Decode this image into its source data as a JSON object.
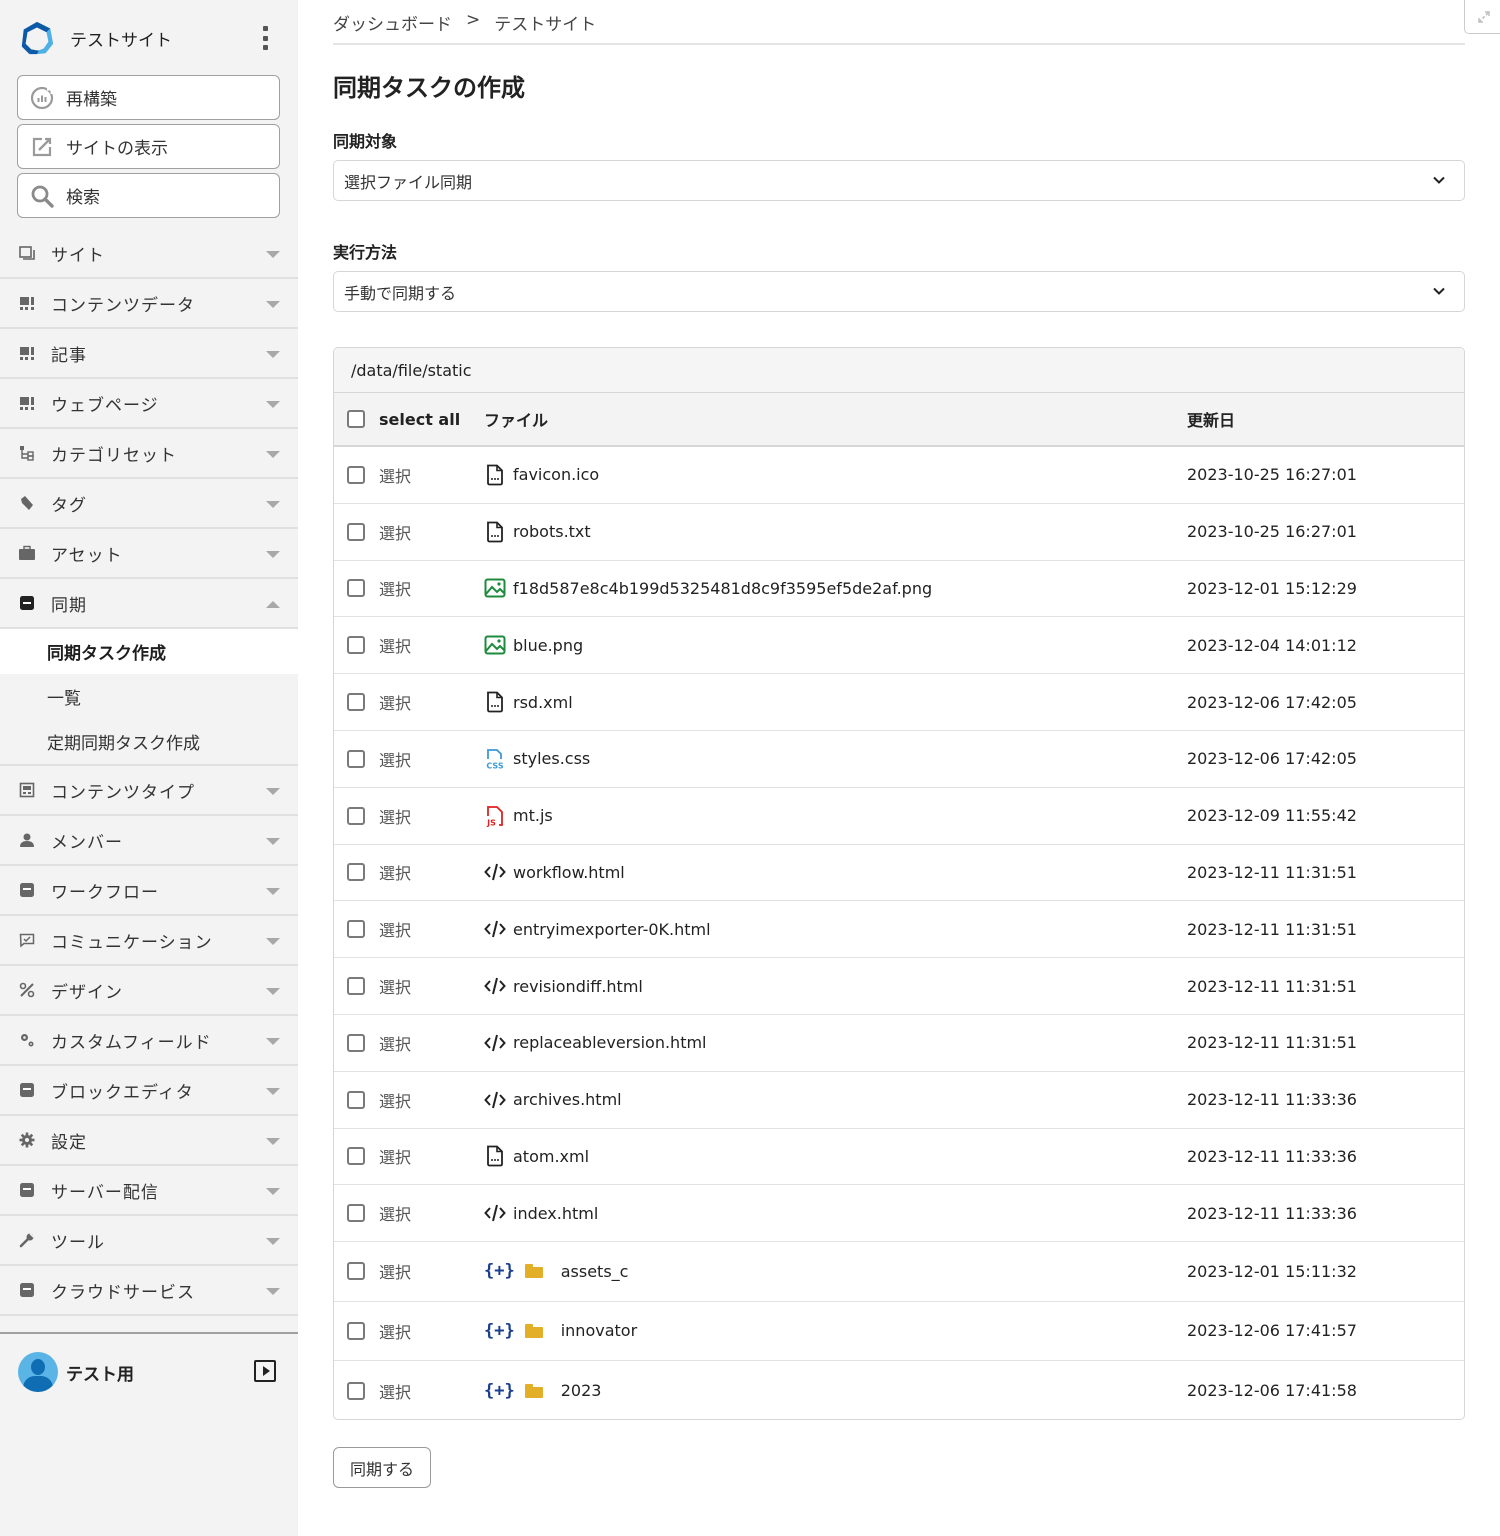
{
  "sidebar": {
    "site_name": "テストサイト",
    "buttons": [
      {
        "label": "再構築",
        "icon": "rebuild-icon"
      },
      {
        "label": "サイトの表示",
        "icon": "external-edit-icon"
      },
      {
        "label": "検索",
        "icon": "search-icon"
      }
    ],
    "nav": [
      {
        "label": "サイト",
        "icon": "site-icon"
      },
      {
        "label": "コンテンツデータ",
        "icon": "content-data-icon"
      },
      {
        "label": "記事",
        "icon": "entry-icon"
      },
      {
        "label": "ウェブページ",
        "icon": "webpage-icon"
      },
      {
        "label": "カテゴリセット",
        "icon": "category-set-icon"
      },
      {
        "label": "タグ",
        "icon": "tag-icon"
      },
      {
        "label": "アセット",
        "icon": "asset-icon"
      },
      {
        "label": "同期",
        "icon": "sync-icon",
        "expanded": true
      },
      {
        "label": "コンテンツタイプ",
        "icon": "content-type-icon"
      },
      {
        "label": "メンバー",
        "icon": "member-icon"
      },
      {
        "label": "ワークフロー",
        "icon": "workflow-icon"
      },
      {
        "label": "コミュニケーション",
        "icon": "communication-icon"
      },
      {
        "label": "デザイン",
        "icon": "design-icon"
      },
      {
        "label": "カスタムフィールド",
        "icon": "custom-field-icon"
      },
      {
        "label": "ブロックエディタ",
        "icon": "block-editor-icon"
      },
      {
        "label": "設定",
        "icon": "settings-icon"
      },
      {
        "label": "サーバー配信",
        "icon": "server-delivery-icon"
      },
      {
        "label": "ツール",
        "icon": "tools-icon"
      },
      {
        "label": "クラウドサービス",
        "icon": "cloud-service-icon"
      }
    ],
    "sync_sub": [
      {
        "label": "同期タスク作成",
        "active": true
      },
      {
        "label": "一覧",
        "active": false
      },
      {
        "label": "定期同期タスク作成",
        "active": false
      }
    ],
    "user": {
      "name": "テスト用"
    }
  },
  "breadcrumb": {
    "items": [
      "ダッシュボード",
      "テストサイト"
    ],
    "separator": ">"
  },
  "page": {
    "title": "同期タスクの作成",
    "target_label": "同期対象",
    "target_value": "選択ファイル同期",
    "method_label": "実行方法",
    "method_value": "手動で同期する"
  },
  "file_table": {
    "path": "/data/file/static",
    "headers": {
      "select_all": "select all",
      "file": "ファイル",
      "updated": "更新日"
    },
    "select_label": "選択",
    "rows": [
      {
        "name": "favicon.ico",
        "type": "file",
        "updated": "2023-10-25 16:27:01"
      },
      {
        "name": "robots.txt",
        "type": "file",
        "updated": "2023-10-25 16:27:01"
      },
      {
        "name": "f18d587e8c4b199d5325481d8c9f3595ef5de2af.png",
        "type": "image",
        "updated": "2023-12-01 15:12:29"
      },
      {
        "name": "blue.png",
        "type": "image",
        "updated": "2023-12-04 14:01:12"
      },
      {
        "name": "rsd.xml",
        "type": "file",
        "updated": "2023-12-06 17:42:05"
      },
      {
        "name": "styles.css",
        "type": "css",
        "updated": "2023-12-06 17:42:05"
      },
      {
        "name": "mt.js",
        "type": "js",
        "updated": "2023-12-09 11:55:42"
      },
      {
        "name": "workflow.html",
        "type": "html",
        "updated": "2023-12-11 11:31:51"
      },
      {
        "name": "entryimexporter-0K.html",
        "type": "html",
        "updated": "2023-12-11 11:31:51"
      },
      {
        "name": "revisiondiff.html",
        "type": "html",
        "updated": "2023-12-11 11:31:51"
      },
      {
        "name": "replaceableversion.html",
        "type": "html",
        "updated": "2023-12-11 11:31:51"
      },
      {
        "name": "archives.html",
        "type": "html",
        "updated": "2023-12-11 11:33:36"
      },
      {
        "name": "atom.xml",
        "type": "file",
        "updated": "2023-12-11 11:33:36"
      },
      {
        "name": "index.html",
        "type": "html",
        "updated": "2023-12-11 11:33:36"
      },
      {
        "name": "assets_c",
        "type": "folder",
        "updated": "2023-12-01 15:11:32"
      },
      {
        "name": "innovator",
        "type": "folder",
        "updated": "2023-12-06 17:41:57"
      },
      {
        "name": "2023",
        "type": "folder",
        "updated": "2023-12-06 17:41:58"
      }
    ],
    "folder_toggle": "{+}"
  },
  "actions": {
    "sync_button": "同期する"
  },
  "colors": {
    "image_icon": "#1e8a3c",
    "css_icon": "#3a9ad9",
    "js_icon": "#e02020",
    "folder": "#e3ae28",
    "toggle": "#1a3f8f"
  }
}
